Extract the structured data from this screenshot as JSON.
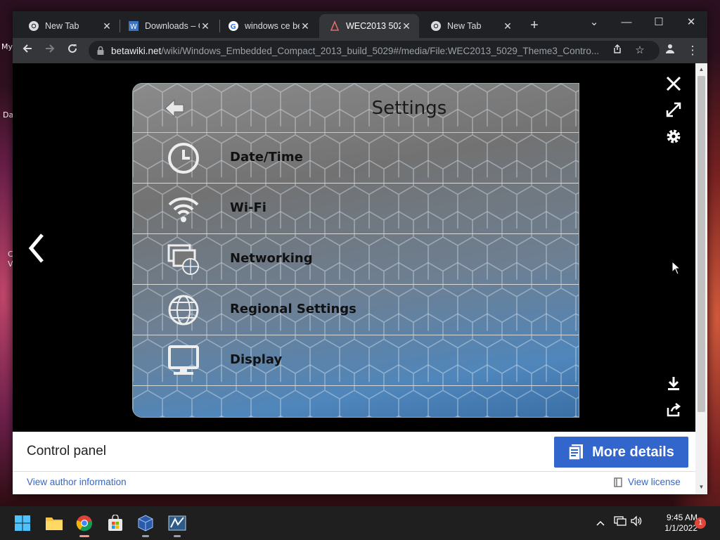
{
  "desktop": {
    "labels": [
      "My",
      "Da",
      "C",
      "V"
    ]
  },
  "browser": {
    "tabs": [
      {
        "title": "New Tab",
        "icon": "chrome-icon",
        "active": false
      },
      {
        "title": "Downloads – C",
        "icon": "wiki-icon",
        "active": false
      },
      {
        "title": "windows ce be",
        "icon": "google-icon",
        "active": false
      },
      {
        "title": "WEC2013 5029",
        "icon": "wec-icon",
        "active": true
      },
      {
        "title": "New Tab",
        "icon": "chrome-icon",
        "active": false
      }
    ],
    "new_tab_symbol": "+",
    "url_host": "betawiki.net",
    "url_path": "/wiki/Windows_Embedded_Compact_2013_build_5029#/media/File:WEC2013_5029_Theme3_Contro...",
    "window_controls": {
      "dropdown": "⌄",
      "minimize": "—",
      "maximize": "☐",
      "close": "✕"
    }
  },
  "screenshot": {
    "title": "Settings",
    "items": [
      {
        "label": "Date/Time",
        "icon": "clock-icon"
      },
      {
        "label": "Wi-Fi",
        "icon": "wifi-icon"
      },
      {
        "label": "Networking",
        "icon": "networking-icon"
      },
      {
        "label": "Regional Settings",
        "icon": "globe-icon"
      },
      {
        "label": "Display",
        "icon": "monitor-icon"
      }
    ]
  },
  "viewer": {
    "caption": "Control panel",
    "more_details_label": "More details",
    "author_link": "View author information",
    "license_link": "View license"
  },
  "taskbar": {
    "time": "9:45 AM",
    "date": "1/1/2022",
    "notification_count": "1"
  },
  "colors": {
    "accent_blue": "#3366cc",
    "chrome_dark": "#202124",
    "chrome_toolbar": "#35363a"
  }
}
